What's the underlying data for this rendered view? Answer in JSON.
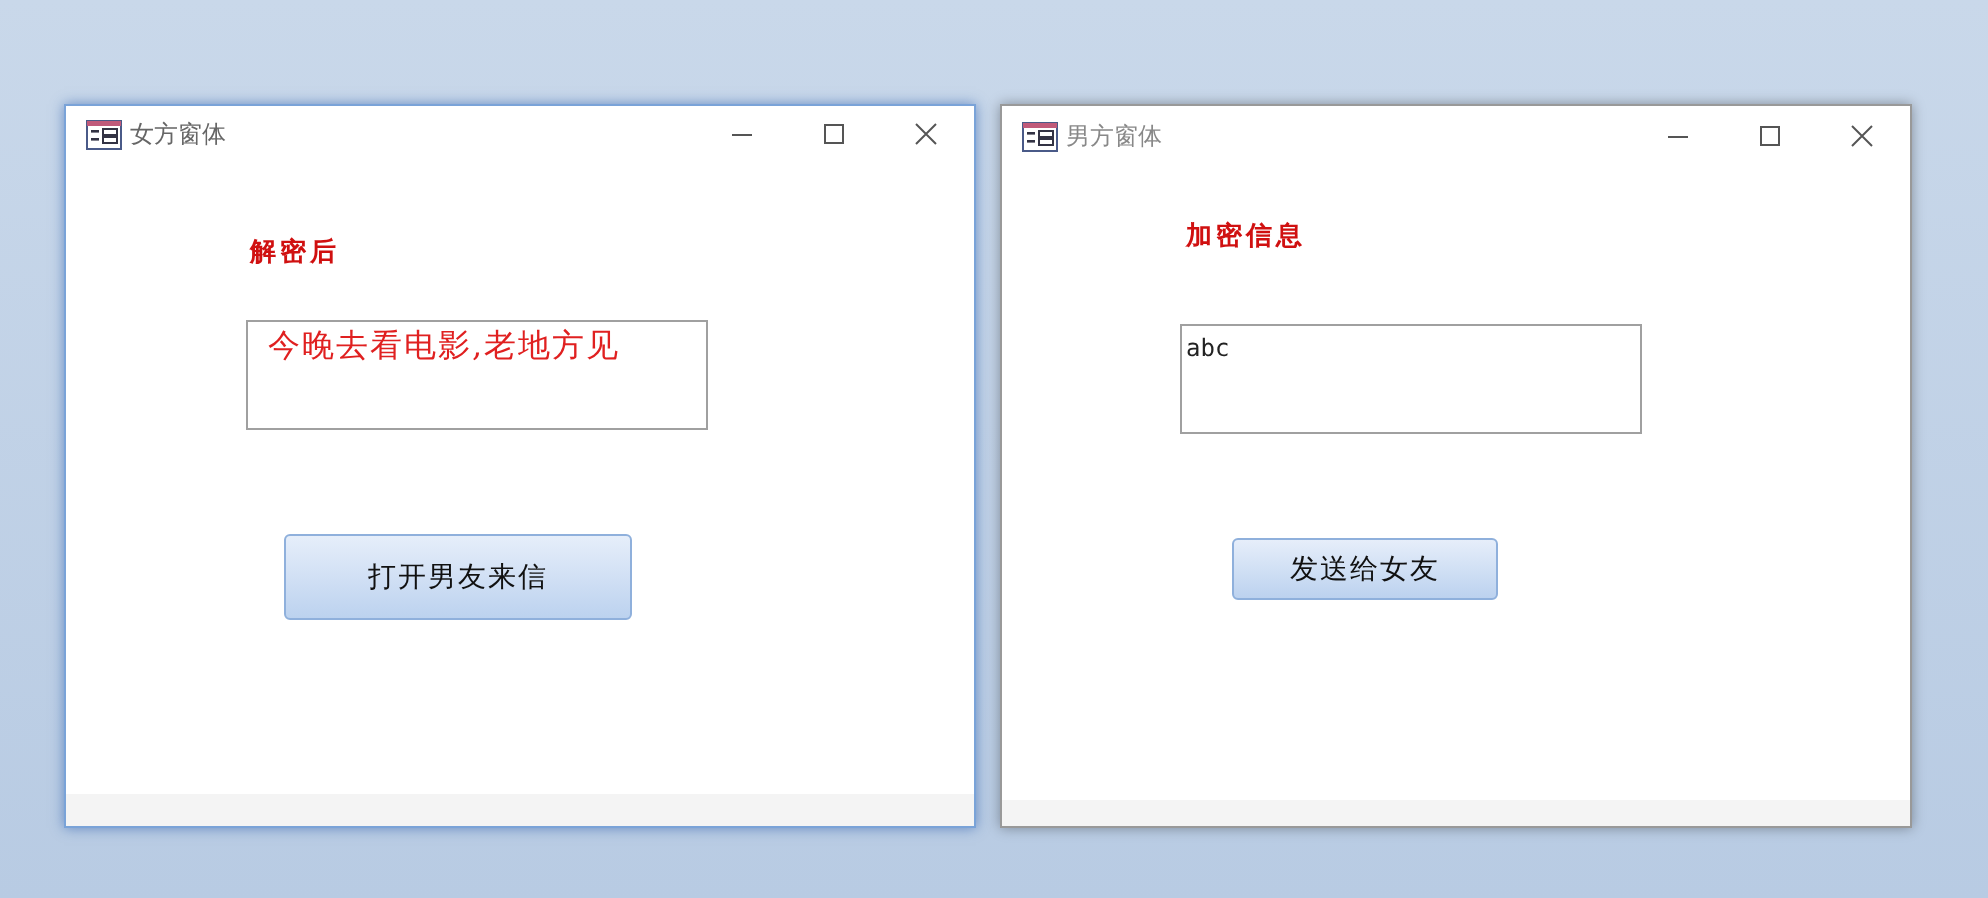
{
  "windows": [
    {
      "title": "女方窗体",
      "active": true,
      "label": "解密后",
      "field": {
        "value": "今晚去看电影,老地方见",
        "kind": "message"
      },
      "button": "打开男友来信"
    },
    {
      "title": "男方窗体",
      "active": false,
      "label": "加密信息",
      "field": {
        "value": "abc",
        "kind": "code"
      },
      "button": "发送给女友"
    }
  ]
}
